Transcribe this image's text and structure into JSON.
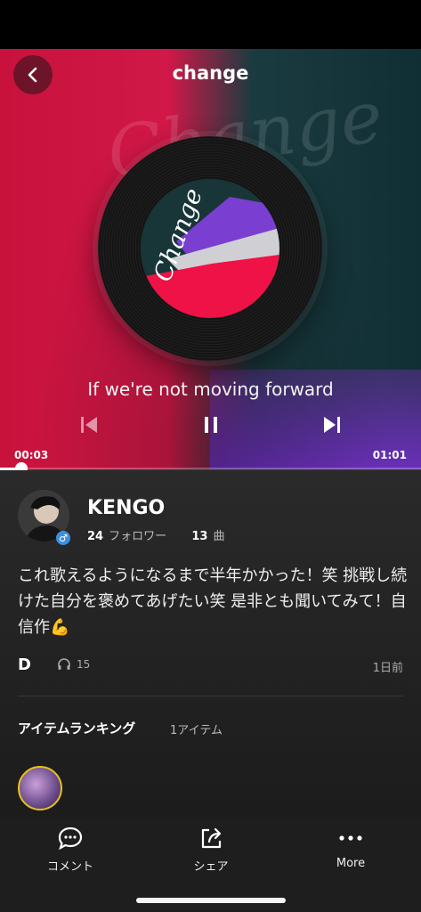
{
  "header": {
    "title": "change"
  },
  "artwork": {
    "cover_text": "Change",
    "background_text": "Change"
  },
  "player": {
    "lyric": "If we're not moving forward",
    "current_time": "00:03",
    "total_time": "01:01",
    "progress": 0.05
  },
  "author": {
    "name": "KENGO",
    "gender_icon": "male-icon",
    "followers_count": "24",
    "followers_label": "フォロワー",
    "songs_count": "13",
    "songs_label": "曲"
  },
  "post": {
    "text": "これ歌えるようになるまで半年かかった！笑 挑戦し続けた自分を褒めてあげたい笑 是非とも聞いてみて！自信作💪",
    "badge": "D",
    "plays": "15",
    "posted": "1日前"
  },
  "ranking": {
    "title": "アイテムランキング",
    "count": "1アイテム"
  },
  "bottom_nav": {
    "comment_label": "コメント",
    "share_label": "シェア",
    "more_label": "More"
  },
  "colors": {
    "accent_red": "#d11848",
    "accent_teal": "#1a3b40",
    "accent_purple": "#6a2fb8",
    "badge_gold": "#e8c21a"
  }
}
